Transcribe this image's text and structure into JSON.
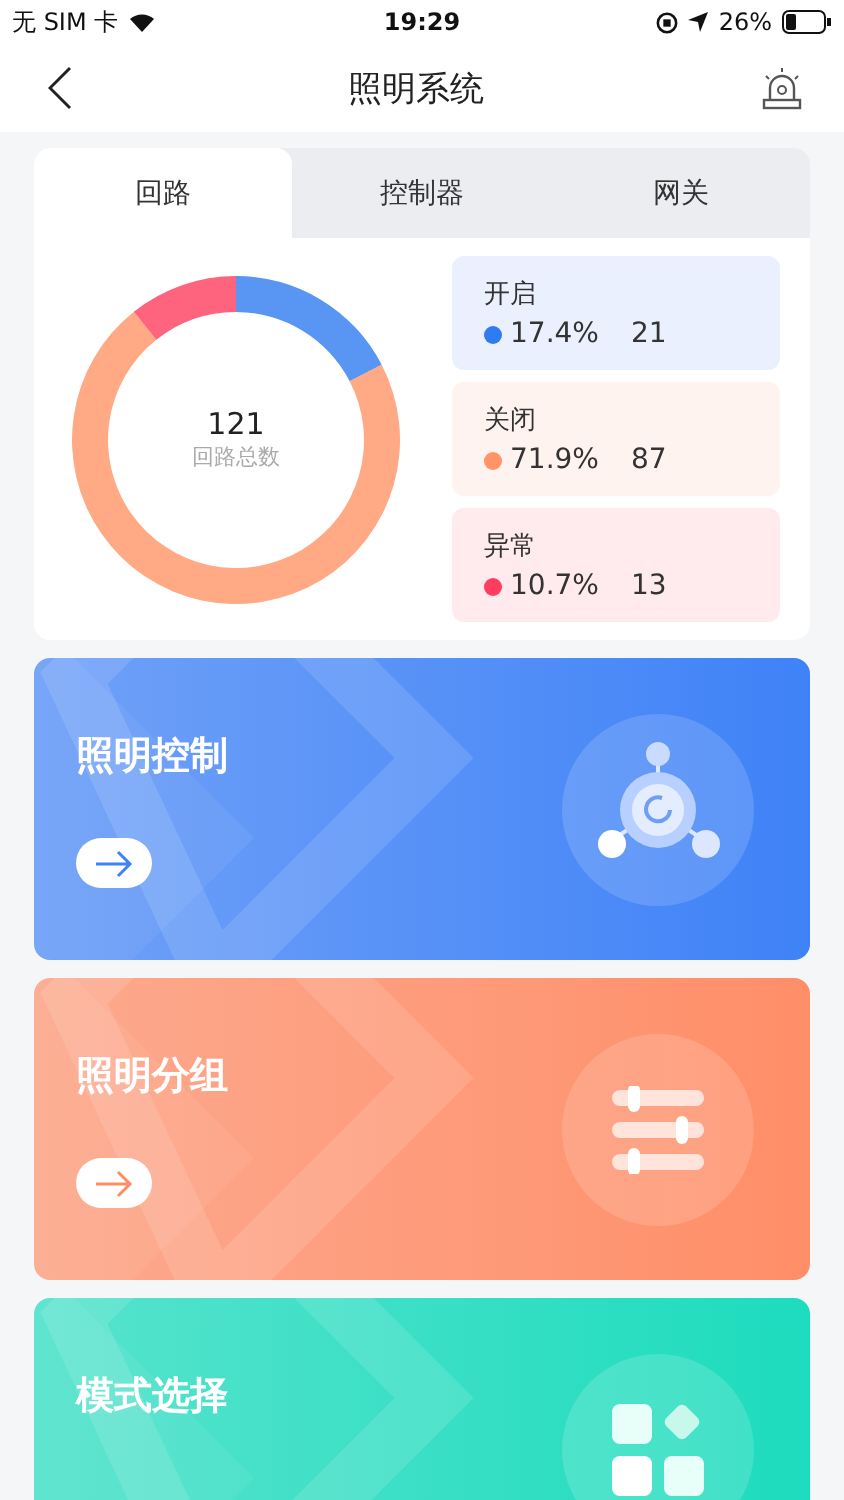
{
  "status_bar": {
    "carrier": "无 SIM 卡",
    "time": "19:29",
    "battery": "26%"
  },
  "nav": {
    "title": "照明系统"
  },
  "tabs": [
    {
      "label": "回路",
      "selected": true
    },
    {
      "label": "控制器",
      "selected": false
    },
    {
      "label": "网关",
      "selected": false
    }
  ],
  "summary": {
    "total": "121",
    "total_label": "回路总数",
    "chart_data": {
      "type": "donut",
      "categories": [
        "开启",
        "关闭",
        "异常"
      ],
      "values": [
        17.4,
        71.9,
        10.7
      ]
    },
    "legend": [
      {
        "percent": "17.4%",
        "count": "21",
        "color": "#2f7bf0"
      },
      {
        "percent": "71.9%",
        "count": "87",
        "color": "#ff9466"
      },
      {
        "percent": "10.7%",
        "count": "13",
        "color": "#ff3d5f"
      }
    ]
  },
  "cards": [
    {
      "title": "照明控制",
      "kind": "control",
      "color": "#3f82f7",
      "arrow": true
    },
    {
      "title": "照明分组",
      "kind": "group",
      "color": "#ff8e68",
      "arrow": true
    },
    {
      "title": "模式选择",
      "kind": "mode",
      "color": "#1ddcbd",
      "arrow": false
    }
  ]
}
